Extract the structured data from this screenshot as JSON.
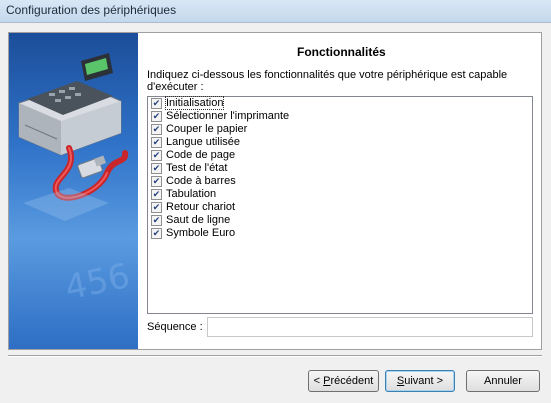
{
  "window": {
    "title": "Configuration des périphériques"
  },
  "main": {
    "heading": "Fonctionnalités",
    "intro": "Indiquez ci-dessous les fonctionnalités que votre périphérique est capable d'exécuter :",
    "features": [
      {
        "label": "Initialisation",
        "checked": true
      },
      {
        "label": "Sélectionner l'imprimante",
        "checked": true
      },
      {
        "label": "Couper le papier",
        "checked": true
      },
      {
        "label": "Langue utilisée",
        "checked": true
      },
      {
        "label": "Code de page",
        "checked": true
      },
      {
        "label": "Test de l'état",
        "checked": true
      },
      {
        "label": "Code à barres",
        "checked": true
      },
      {
        "label": "Tabulation",
        "checked": true
      },
      {
        "label": "Retour chariot",
        "checked": true
      },
      {
        "label": "Saut de ligne",
        "checked": true
      },
      {
        "label": "Symbole Euro",
        "checked": true
      }
    ],
    "sequence_label": "Séquence :",
    "sequence_value": ""
  },
  "buttons": {
    "prev_prefix": "< ",
    "prev_mnemonic": "P",
    "prev_rest": "récédent",
    "next_mnemonic": "S",
    "next_rest": "uivant >",
    "cancel": "Annuler"
  },
  "icons": {
    "banner": "cash-register-cable-icon",
    "check": "checkmark-icon"
  }
}
